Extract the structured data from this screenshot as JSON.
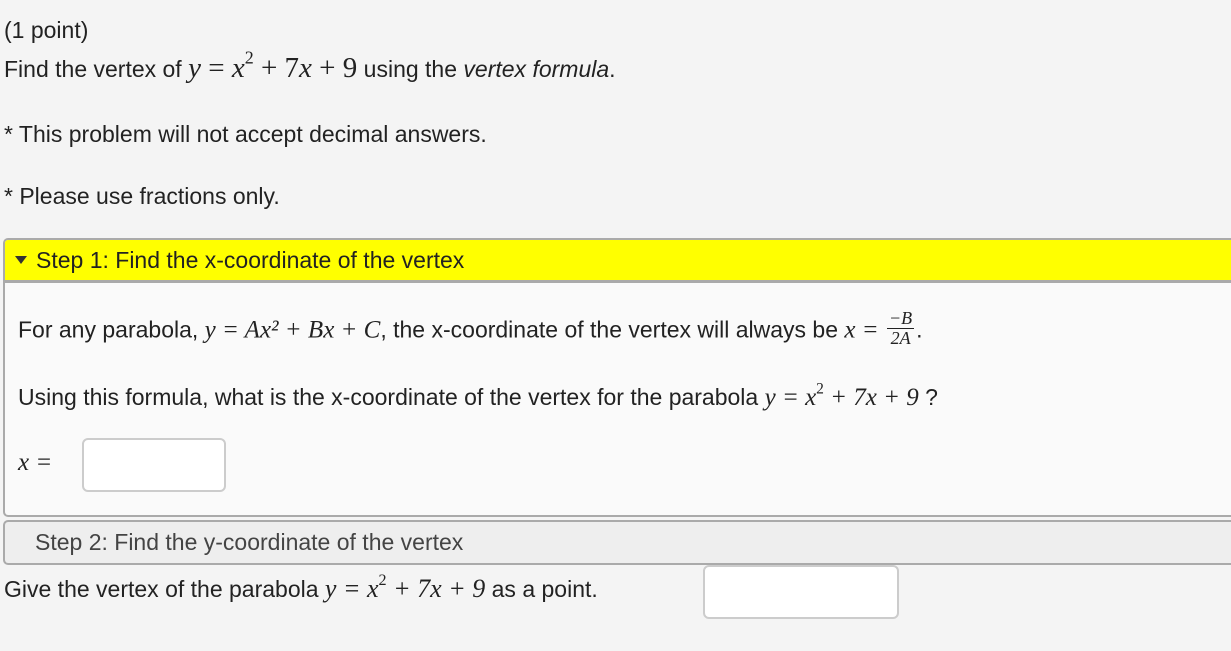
{
  "problem": {
    "points": "(1 point)",
    "prompt_before": "Find the vertex of ",
    "prompt_eq": {
      "lhs": "y",
      "eq": "=",
      "x": "x",
      "exp": "2",
      "rest": "+ 7",
      "x2": "x",
      "tail": "+ 9"
    },
    "prompt_after_1": " using the ",
    "prompt_italic": "vertex formula",
    "prompt_after_2": ".",
    "note1": "* This problem will not accept decimal answers.",
    "note2": "* Please use fractions only."
  },
  "step1": {
    "title": "Step 1: Find the x-coordinate of the vertex",
    "expanded": true,
    "line1_before": "For any parabola, ",
    "line1_eq": "y = Ax² + Bx + C",
    "line1_mid": ", the x-coordinate of the vertex will always be ",
    "line1_x": "x =",
    "frac_num": "−B",
    "frac_den": "2A",
    "line1_end": ".",
    "line2_before": "Using this formula, what is the x-coordinate of the vertex for the parabola ",
    "line2_eq_lhs": "y = x",
    "line2_eq_exp": "2",
    "line2_eq_rest": " + 7x + 9",
    "line2_end": " ?",
    "answer_label": "x =",
    "answer_value": ""
  },
  "step2": {
    "title": "Step 2: Find the y-coordinate of the vertex",
    "expanded": false
  },
  "final": {
    "before": "Give the vertex of the parabola ",
    "eq_lhs": "y = x",
    "eq_exp": "2",
    "eq_rest": " + 7x + 9",
    "after": " as a point.",
    "answer_value": ""
  },
  "colors": {
    "step1_header": "#ffff00",
    "page_bg": "#f4f4f4",
    "panel_border": "#aaaaaa"
  }
}
